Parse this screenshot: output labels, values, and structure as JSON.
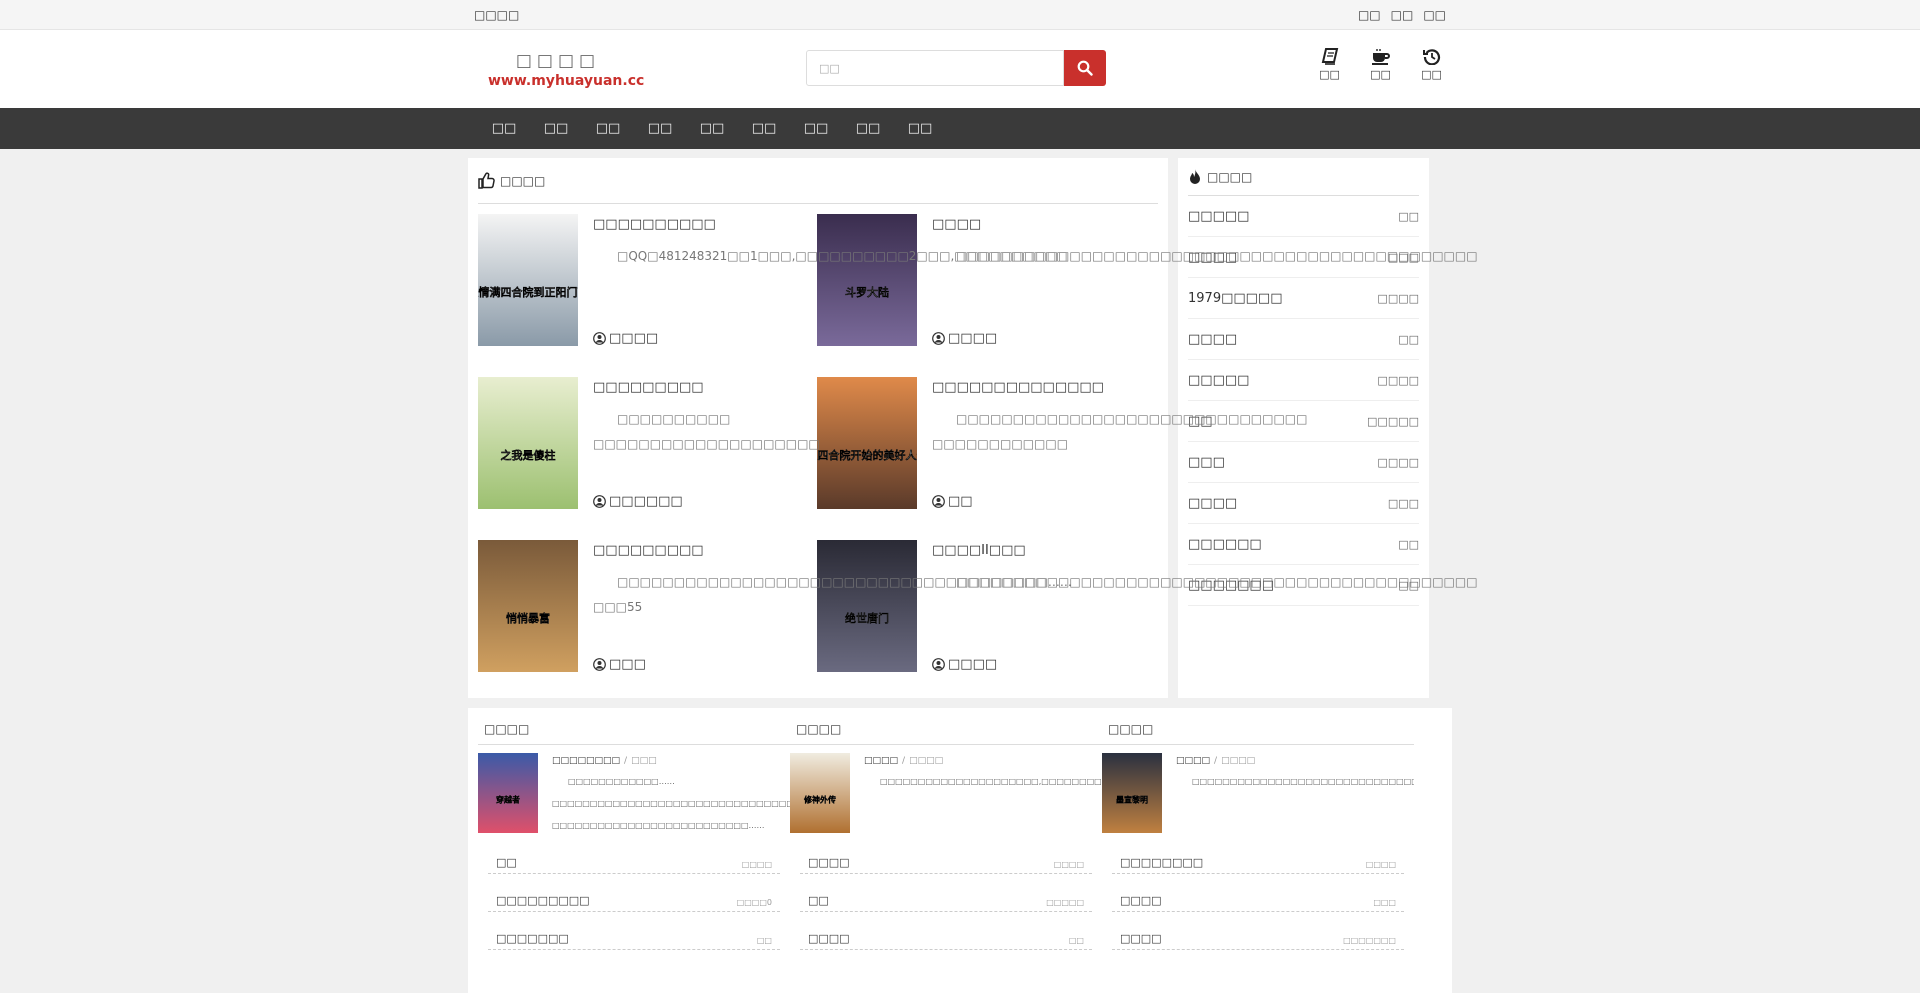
{
  "topbar": {
    "welcome": "□□□□",
    "links": [
      "□□",
      "□□",
      "□□"
    ]
  },
  "header": {
    "site_name": "□□□□",
    "site_url": "www.myhuayuan.cc",
    "search_placeholder": "□□",
    "icons": [
      {
        "label": "□□",
        "icon": "book-icon"
      },
      {
        "label": "□□",
        "icon": "coffee-icon"
      },
      {
        "label": "□□",
        "icon": "history-icon"
      }
    ]
  },
  "nav": {
    "items": [
      "□□",
      "□□",
      "□□",
      "□□",
      "□□",
      "□□",
      "□□",
      "□□",
      "□□"
    ]
  },
  "recommend": {
    "title": "□□□□",
    "books": [
      {
        "title": "□□□□□□□□□□",
        "desc": "□QQ□481248321□□1□□□,□□□□□□□□□□2□□□,□□□□□□□□□□",
        "author": "□□□□",
        "cover_text": "从情满四合院到正阳门下",
        "colors": [
          "#f4f4f4",
          "#8a9aa8"
        ]
      },
      {
        "title": "□□□□",
        "desc": "□□□□□□□□□□□□□□□□□□□□□□□□□□□□□□□□□□□□□□□□□□□□□□",
        "author": "□□□□",
        "cover_text": "斗罗大陆",
        "colors": [
          "#3a2d4e",
          "#7a6a9a"
        ]
      },
      {
        "title": "□□□□□□□□□",
        "desc": "□□□□□□□□□□ □□□□□□□□□□□□□□□□□□□□",
        "author": "□□□□□□",
        "cover_text": "之我是傻柱",
        "colors": [
          "#e8eed0",
          "#9cc070"
        ]
      },
      {
        "title": "□□□□□□□□□□□□□□",
        "desc": "□□□□□□□□□□□□□□□□□□□□□□□□□□□□□□□ □□□□□□□□□□□□",
        "author": "□□",
        "cover_text": "从四合院开始的美好人生",
        "colors": [
          "#e08a4a",
          "#5a3a2a"
        ]
      },
      {
        "title": "□□□□□□□□□",
        "desc": "□□□□□□□□□□□□□□□□□□□□□□□□□□□□□□□□□□□□□□……□□□55",
        "author": "□□□",
        "cover_text": "悄悄暴富",
        "colors": [
          "#7a5a3a",
          "#d0a060"
        ]
      },
      {
        "title": "□□□□II□□□",
        "desc": "□□□□□□□□□□□□□□□□□□□□□□□□□□□□□□□□□□□□□□□□□□□□□□",
        "author": "□□□□",
        "cover_text": "绝世唐门",
        "colors": [
          "#2a2a35",
          "#6a6a80"
        ]
      }
    ]
  },
  "hot": {
    "title": "□□□□",
    "items": [
      {
        "title": "□□□□□",
        "author": "□□"
      },
      {
        "title": "□□□□",
        "author": "□□□"
      },
      {
        "title": "1979□□□□□",
        "author": "□□□□"
      },
      {
        "title": "□□□□",
        "author": "□□"
      },
      {
        "title": "□□□□□",
        "author": "□□□□"
      },
      {
        "title": "□□",
        "author": "□□□□□"
      },
      {
        "title": "□□□",
        "author": "□□□□"
      },
      {
        "title": "□□□□",
        "author": "□□□"
      },
      {
        "title": "□□□□□□",
        "author": "□□"
      },
      {
        "title": "□□□□□□□",
        "author": "□□"
      }
    ]
  },
  "categories": [
    {
      "heading": "□□□□",
      "book_title": "□□□□□□□□",
      "book_author": "□□□",
      "desc": "□□□□□□□□□□□□……□□□□□□□□□□□□□□□□□□□□□□□□□□□□□□□□□□□□□□□□□□□□□□□□□□□□□□□□□□□□□□□□□□□□□□□□□□□□□□□□□□□□□□□□□□□□□□□……□□□□□□□□□□□□□□□□□□□□□□□□□□……",
      "cover_text": "穿越者",
      "colors": [
        "#3a5aa8",
        "#e0506a"
      ]
    },
    {
      "heading": "□□□□",
      "book_title": "□□□□",
      "book_author": "□□□□",
      "desc": "□□□□□□□□□□□□□□□□□□□□□,□□□□□□□□□□□□□□□□□□□□□□□□□□□□□□□□□□□□□□□□□□□□□□□□□□□□□□□□□□□□□□□□□□□□□□□□□□□□□□□□□□□□□□□□□□□□□□□□□□□□□□□□□□□□□□□□□□□",
      "cover_text": "修神外传",
      "colors": [
        "#f0ece0",
        "#b07030"
      ]
    },
    {
      "heading": "□□□□",
      "book_title": "□□□□",
      "book_author": "□□□□",
      "desc": "□□□□□□□□□□□□□□□□□□□□□□□□□□□□□□□□□□□□□□□□□□□□□□□□□□□□□□□□□□;...□□□□",
      "cover_text": "墨宣黎明",
      "colors": [
        "#2a3040",
        "#c08040"
      ]
    }
  ],
  "links": [
    {
      "title": "□□",
      "author": "□□□□"
    },
    {
      "title": "□□□□",
      "author": "□□□□"
    },
    {
      "title": "□□□□□□□□",
      "author": "□□□□"
    },
    {
      "title": "□□□□□□□□□",
      "author": "□□□□0"
    },
    {
      "title": "□□",
      "author": "□□□□□"
    },
    {
      "title": "□□□□",
      "author": "□□□"
    },
    {
      "title": "□□□□□□□",
      "author": "□□"
    },
    {
      "title": "□□□□",
      "author": "□□"
    },
    {
      "title": "□□□□",
      "author": "□□□□□□□"
    }
  ],
  "colors": {
    "accent": "#c9302c",
    "nav_bg": "#3a3a3a"
  }
}
